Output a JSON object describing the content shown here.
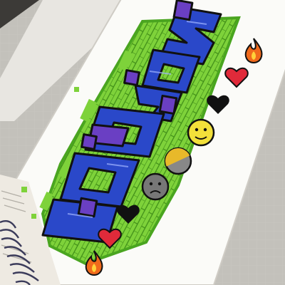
{
  "photo": {
    "subject": "graffiti-lettering-drawing",
    "background_color": "#b9b6b0",
    "grid_paper_color": "#d8d6d0",
    "sheet_color": "#fbfbf8",
    "wall_color": "#7ed23a",
    "wall_shadow_color": "#5fae22",
    "letter_color": "#2a48c9",
    "letter_shadow_color": "#6a3fc3",
    "outline_color": "#111111"
  },
  "decorations": {
    "items": [
      {
        "kind": "flame",
        "icon": "flame-icon",
        "color": "#f06a1c"
      },
      {
        "kind": "heart",
        "icon": "heart-icon",
        "color": "#e02a3a"
      },
      {
        "kind": "heart",
        "icon": "heart-icon",
        "color": "#111111"
      },
      {
        "kind": "face",
        "icon": "smiley-face-icon",
        "color": "#f2e03a"
      },
      {
        "kind": "half-circle",
        "icon": "half-filled-circle-icon",
        "color": "#e8b92a"
      },
      {
        "kind": "face",
        "icon": "sad-face-icon",
        "color": "#777777"
      },
      {
        "kind": "heart",
        "icon": "heart-icon",
        "color": "#111111"
      },
      {
        "kind": "heart",
        "icon": "heart-icon",
        "color": "#e02a3a"
      },
      {
        "kind": "flame",
        "icon": "flame-icon",
        "color": "#f06a1c"
      }
    ]
  }
}
